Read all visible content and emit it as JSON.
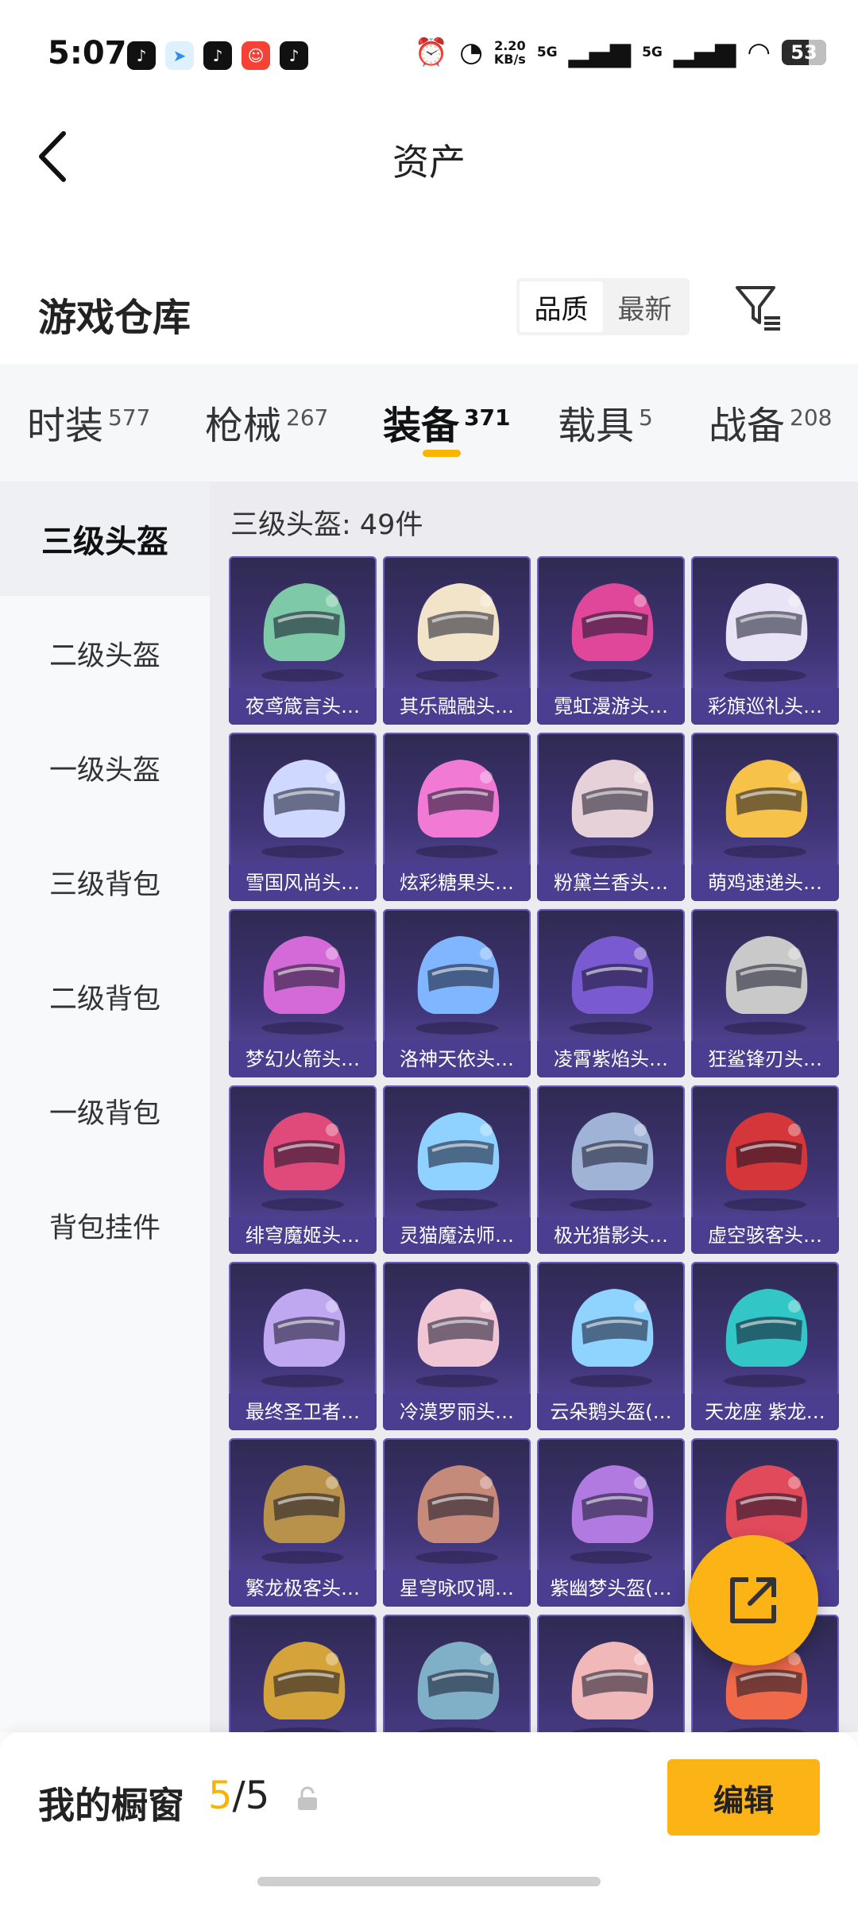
{
  "status_bar": {
    "time": "5:07",
    "net_speed": "2.20\nKB/s",
    "net_speed_top": "2.20",
    "net_speed_bottom": "KB/s",
    "signal1": "5G",
    "signal2": "5G",
    "battery": "53"
  },
  "header": {
    "title": "资产"
  },
  "warehouse": {
    "title": "游戏仓库",
    "sort_options": [
      "品质",
      "最新"
    ]
  },
  "categories": [
    {
      "label": "时装",
      "count": "577"
    },
    {
      "label": "枪械",
      "count": "267"
    },
    {
      "label": "装备",
      "count": "371"
    },
    {
      "label": "载具",
      "count": "5"
    },
    {
      "label": "战备",
      "count": "208"
    }
  ],
  "subnav": [
    "三级头盔",
    "二级头盔",
    "一级头盔",
    "三级背包",
    "二级背包",
    "一级背包",
    "背包挂件"
  ],
  "list_title": "三级头盔: 49件",
  "items": [
    {
      "name": "夜鸢箴言头…",
      "icon": "helmet-icon",
      "accent": "#7ec9a8"
    },
    {
      "name": "其乐融融头…",
      "icon": "helmet-icon",
      "accent": "#f1e4c8"
    },
    {
      "name": "霓虹漫游头…",
      "icon": "helmet-icon",
      "accent": "#e0469a"
    },
    {
      "name": "彩旗巡礼头…",
      "icon": "helmet-icon",
      "accent": "#e9e4f5"
    },
    {
      "name": "雪国风尚头…",
      "icon": "helmet-icon",
      "accent": "#cfd9ff"
    },
    {
      "name": "炫彩糖果头…",
      "icon": "helmet-icon",
      "accent": "#f07ad4"
    },
    {
      "name": "粉黛兰香头…",
      "icon": "helmet-icon",
      "accent": "#e6d1d8"
    },
    {
      "name": "萌鸡速递头…",
      "icon": "helmet-icon",
      "accent": "#f6c24a"
    },
    {
      "name": "梦幻火箭头…",
      "icon": "helmet-icon",
      "accent": "#d46ad8"
    },
    {
      "name": "洛神天依头…",
      "icon": "helmet-icon",
      "accent": "#7fb6ff"
    },
    {
      "name": "凌霄紫焰头…",
      "icon": "helmet-icon",
      "accent": "#7a5ad0"
    },
    {
      "name": "狂鲨锋刃头…",
      "icon": "helmet-icon",
      "accent": "#c9c9c9"
    },
    {
      "name": "绯穹魔姬头…",
      "icon": "helmet-icon",
      "accent": "#e04a7a"
    },
    {
      "name": "灵猫魔法师…",
      "icon": "helmet-icon",
      "accent": "#8fd1ff"
    },
    {
      "name": "极光猎影头…",
      "icon": "helmet-icon",
      "accent": "#9fb3d6"
    },
    {
      "name": "虚空骇客头…",
      "icon": "helmet-icon",
      "accent": "#d4363a"
    },
    {
      "name": "最终圣卫者…",
      "icon": "helmet-icon",
      "accent": "#c0a8f0"
    },
    {
      "name": "冷漠罗丽头…",
      "icon": "helmet-icon",
      "accent": "#f0c6d4"
    },
    {
      "name": "云朵鹅头盔(…",
      "icon": "helmet-icon",
      "accent": "#8fd3ff"
    },
    {
      "name": "天龙座 紫龙…",
      "icon": "helmet-icon",
      "accent": "#32c6c6"
    },
    {
      "name": "繁龙极客头…",
      "icon": "helmet-icon",
      "accent": "#b8924a"
    },
    {
      "name": "星穹咏叹调…",
      "icon": "helmet-icon",
      "accent": "#c68a7a"
    },
    {
      "name": "紫幽梦头盔(…",
      "icon": "helmet-icon",
      "accent": "#b07ae0"
    },
    {
      "name": "",
      "icon": "helmet-icon",
      "accent": "#e04a5a"
    },
    {
      "name": "",
      "icon": "helmet-icon",
      "accent": "#d4a43a"
    },
    {
      "name": "",
      "icon": "helmet-icon",
      "accent": "#7fb0c8"
    },
    {
      "name": "",
      "icon": "helmet-icon",
      "accent": "#f0b8b8"
    },
    {
      "name": "",
      "icon": "helmet-icon",
      "accent": "#f06a4a"
    }
  ],
  "showcase": {
    "title": "我的橱窗",
    "used": "5",
    "separator": "/",
    "total": "5",
    "edit_label": "编辑"
  },
  "colors": {
    "accent": "#fcb316",
    "card_bg": "#3f3475"
  }
}
